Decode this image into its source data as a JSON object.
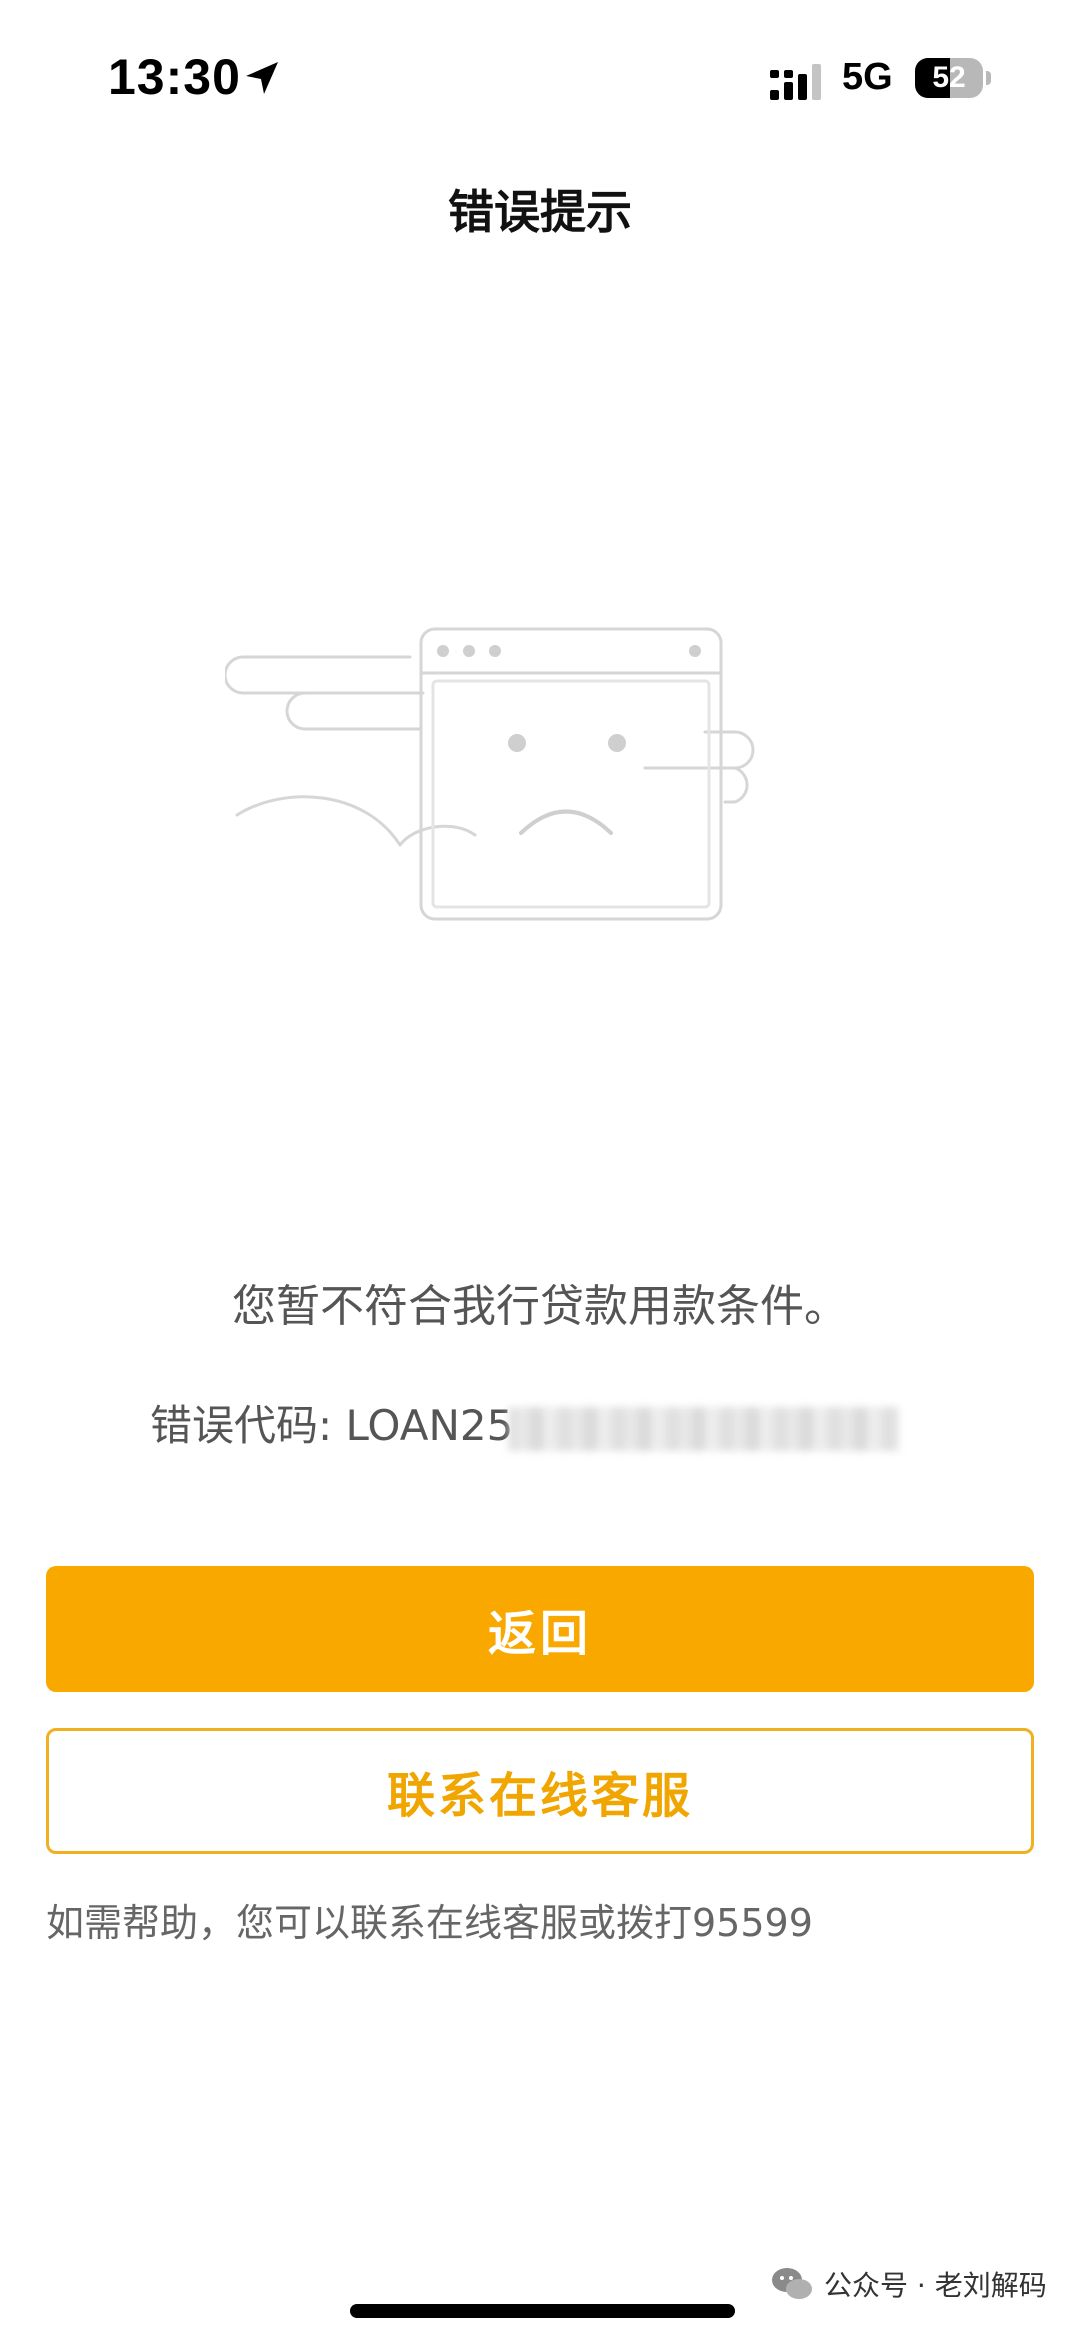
{
  "status_bar": {
    "time": "13:30",
    "network": "5G",
    "battery_level": "52",
    "battery_fraction": 0.52,
    "icons": [
      "location-arrow-icon",
      "signal-bars-icon",
      "battery-icon"
    ]
  },
  "header": {
    "title": "错误提示"
  },
  "illustration": {
    "icon": "sad-browser-window-icon"
  },
  "main": {
    "message": "您暂不符合我行贷款用款条件。",
    "error_code_label": "错误代码: LOAN25"
  },
  "actions": {
    "back_label": "返回",
    "contact_label": "联系在线客服"
  },
  "help": {
    "text": "如需帮助，您可以联系在线客服或拨打95599"
  },
  "watermark": {
    "text": "公众号 · 老刘解码",
    "icon": "wechat-icon"
  },
  "colors": {
    "accent": "#f9a800",
    "secondary_border": "#f0b020",
    "text_muted": "#555555"
  }
}
